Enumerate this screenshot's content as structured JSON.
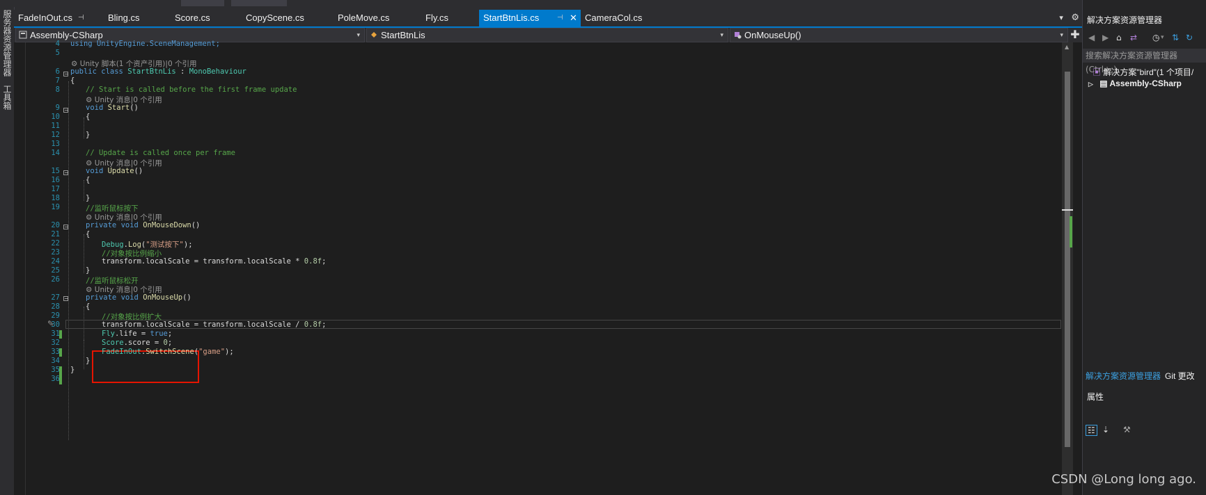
{
  "left_strip": {
    "items": [
      "服务器资源管理器",
      "工具箱"
    ]
  },
  "tabs": [
    {
      "label": "FadeInOut.cs",
      "pinned": true
    },
    {
      "label": "Bling.cs"
    },
    {
      "label": "Score.cs"
    },
    {
      "label": "CopyScene.cs"
    },
    {
      "label": "PoleMove.cs"
    },
    {
      "label": "Fly.cs"
    },
    {
      "label": "StartBtnLis.cs",
      "active": true,
      "pinned": true
    },
    {
      "label": "CameraCol.cs"
    }
  ],
  "navbar": {
    "project": "Assembly-CSharp",
    "class": "StartBtnLis",
    "member": "OnMouseUp()"
  },
  "editor": {
    "line_numbers": [
      "4",
      "5",
      "6",
      "7",
      "8",
      "9",
      "10",
      "11",
      "12",
      "13",
      "14",
      "15",
      "16",
      "17",
      "18",
      "19",
      "20",
      "21",
      "22",
      "23",
      "24",
      "25",
      "26",
      "27",
      "28",
      "29",
      "30",
      "31",
      "32",
      "33",
      "34",
      "35",
      "36"
    ],
    "lens": {
      "class": "Unity 脚本(1 个资产引用)|0 个引用",
      "start": "Unity 消息|0 个引用",
      "update": "Unity 消息|0 个引用",
      "down": "Unity 消息|0 个引用",
      "up": "Unity 消息|0 个引用"
    },
    "lines": {
      "l4": "using UnityEngine.SceneManagement;",
      "l6a": "public class ",
      "l6b": "StartBtnLis",
      "l6c": " : ",
      "l6d": "MonoBehaviour",
      "l7": "{",
      "l8": "// Start is called before the first frame update",
      "l9a": "void ",
      "l9b": "Start",
      "l9c": "()",
      "l10": "{",
      "l12": "}",
      "l14": "// Update is called once per frame",
      "l15a": "void ",
      "l15b": "Update",
      "l15c": "()",
      "l16": "{",
      "l18": "}",
      "l19": "//监听鼠标按下",
      "l20a": "private void ",
      "l20b": "OnMouseDown",
      "l20c": "()",
      "l21": "{",
      "l22a": "Debug",
      "l22b": ".",
      "l22c": "Log",
      "l22d": "(",
      "l22e": "\"测试按下\"",
      "l22f": ");",
      "l23": "//对象按比例缩小",
      "l24a": "transform.localScale = transform.localScale * ",
      "l24b": "0.8f",
      "l24c": ";",
      "l25": "}",
      "l26": "//监听鼠标松开",
      "l27a": "private void ",
      "l27b": "OnMouseUp",
      "l27c": "()",
      "l28": "{",
      "l29": "//对象按比例扩大",
      "l30a": "transform.localScale = transform.localScale / ",
      "l30b": "0.8f",
      "l30c": ";",
      "l31a": "Fly",
      "l31b": ".life = ",
      "l31c": "true",
      "l31d": ";",
      "l32a": "Score",
      "l32b": ".score = ",
      "l32c": "0",
      "l32d": ";",
      "l33a": "FadeInOut",
      "l33b": ".",
      "l33c": "SwitchScene",
      "l33d": "(",
      "l33e": "\"game\"",
      "l33f": ");",
      "l34": "}",
      "l35": "}"
    }
  },
  "solution_explorer": {
    "title": "解决方案资源管理器",
    "search_placeholder": "搜索解决方案资源管理器(Ctrl+;)",
    "solution_label": "解决方案\"bird\"(1 个项目/",
    "project_label": "Assembly-CSharp",
    "bottom_tabs": [
      "解决方案资源管理器",
      "Git 更改"
    ]
  },
  "properties": {
    "title": "属性"
  },
  "watermark": "CSDN @Long long ago.",
  "colors": {
    "accent": "#007acc",
    "editor_bg": "#1e1e1e",
    "keyword": "#569cd6",
    "type": "#4ec9b0",
    "comment": "#57a64a",
    "string": "#d69d85",
    "highlight_box": "#e51400"
  }
}
